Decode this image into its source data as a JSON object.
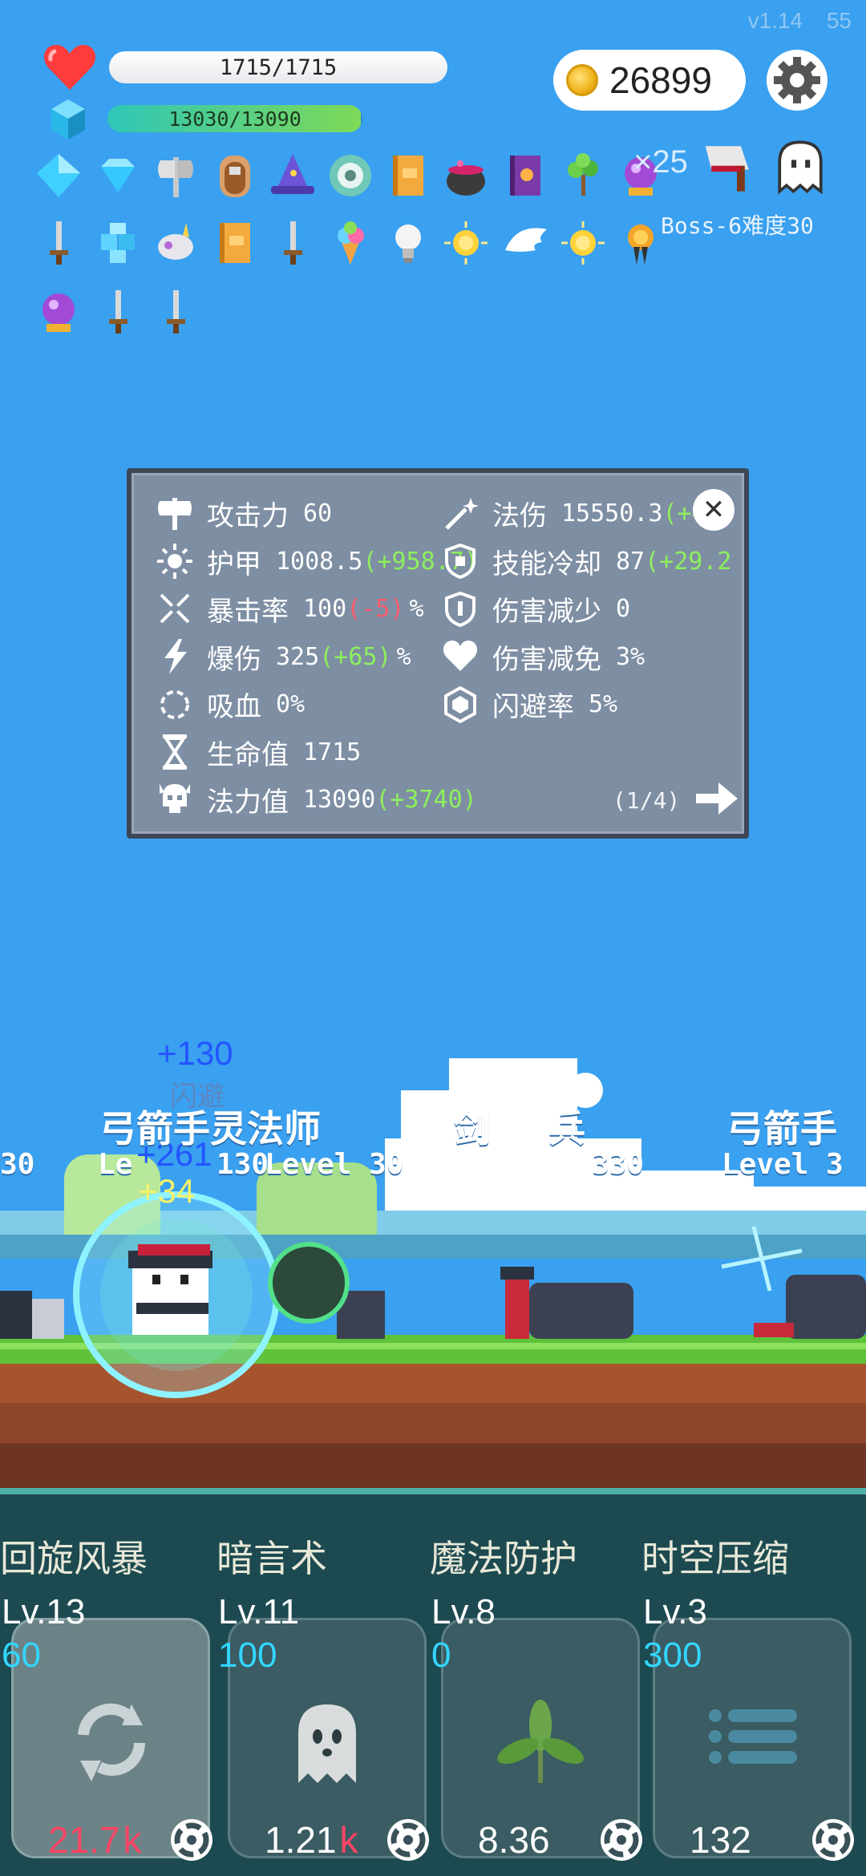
{
  "hud": {
    "version": "v1.14",
    "version_suffix": "55",
    "hp_text": "1715/1715",
    "hp_fraction": 1.0,
    "mp_text": "13030/13090",
    "mp_fraction": 0.995,
    "gold": "26899"
  },
  "inventory": {
    "stack_count": "×25",
    "boss_label": "Boss-6难度30",
    "items": [
      "diamond-icon",
      "blue-gem-icon",
      "axe-icon",
      "wooden-door-icon",
      "wizard-hat-icon",
      "round-shield-icon",
      "orange-book-icon",
      "cauldron-icon",
      "purple-book-icon",
      "sapling-icon",
      "crystal-ball-icon",
      "cleaver-icon",
      "ghost-icon",
      "sword-icon",
      "ice-blocks-icon",
      "unicorn-icon",
      "orange-book-icon",
      "sword-icon",
      "ice-cream-icon",
      "lightbulb-icon",
      "gold-star-icon",
      "wing-icon",
      "gold-star-icon",
      "medal-icon",
      "crystal-ball-icon",
      "sword-icon",
      "sword-icon"
    ]
  },
  "stats_panel": {
    "left": [
      {
        "icon": "axe-icon",
        "label": "攻击力",
        "value": "60",
        "bonus": "",
        "unit": ""
      },
      {
        "icon": "sun-icon",
        "label": "护甲",
        "value": "1008.5",
        "bonus": "(+958.7)",
        "bonus_type": "pos",
        "unit": ""
      },
      {
        "icon": "crossed-swords-icon",
        "label": "暴击率",
        "value": "100",
        "bonus": "(-5)",
        "bonus_type": "neg",
        "unit": "%"
      },
      {
        "icon": "lightning-icon",
        "label": "爆伤",
        "value": "325",
        "bonus": "(+65)",
        "bonus_type": "pos",
        "unit": "%"
      },
      {
        "icon": "ring-icon",
        "label": "吸血",
        "value": "0%",
        "bonus": "",
        "unit": ""
      },
      {
        "icon": "hourglass-icon",
        "label": "生命值",
        "value": "1715",
        "bonus": "",
        "unit": ""
      },
      {
        "icon": "skull-icon",
        "label": "法力值",
        "value": "13090",
        "bonus": "(+3740)",
        "bonus_type": "pos",
        "unit": ""
      }
    ],
    "right": [
      {
        "icon": "magic-wand-icon",
        "label": "法伤",
        "value": "15550.3",
        "bonus": "(+47",
        "bonus_type": "pos",
        "unit": ""
      },
      {
        "icon": "shield-icon",
        "label": "技能冷却",
        "value": "87",
        "bonus": "(+29.2",
        "bonus_type": "pos",
        "unit": ""
      },
      {
        "icon": "shield-check-icon",
        "label": "伤害减少",
        "value": "0",
        "bonus": "",
        "unit": ""
      },
      {
        "icon": "heart-icon",
        "label": "伤害减免",
        "value": "3%",
        "bonus": "",
        "unit": ""
      },
      {
        "icon": "hexagon-icon",
        "label": "闪避率",
        "value": "5%",
        "bonus": "",
        "unit": ""
      }
    ],
    "page": "(1/4)"
  },
  "battle": {
    "float_texts": [
      "+130",
      "闪避",
      "+261",
      "+34"
    ],
    "enemies": [
      {
        "name": "弓箭手灵法师",
        "level": "Level 30"
      },
      {
        "name": "剑",
        "suffix": "兵",
        "level": "330"
      },
      {
        "name": "弓箭手",
        "level": "Level 3"
      }
    ],
    "left_level_fragment": "30",
    "mid_level_fragment": "Le",
    "overlap_level": "130"
  },
  "skills": [
    {
      "name": "回旋风暴",
      "level": "Lv.13",
      "cost": "60",
      "price": "21.7",
      "price_unit": "k",
      "icon": "swirl-icon",
      "active": true
    },
    {
      "name": "暗言术",
      "level": "Lv.11",
      "cost": "100",
      "price": "1.21",
      "price_unit": "k",
      "icon": "ghost-icon",
      "active": false
    },
    {
      "name": "魔法防护",
      "level": "Lv.8",
      "cost": "0",
      "price": "8.36",
      "price_unit": "",
      "icon": "leaf-icon",
      "active": false
    },
    {
      "name": "时空压缩",
      "level": "Lv.3",
      "cost": "300",
      "price": "132",
      "price_unit": "",
      "icon": "list-icon",
      "active": false
    }
  ],
  "colors": {
    "sky": "#3aa0f0",
    "grass": "#5fc23b",
    "dirt": "#a7542e",
    "panel": "#7e8ea3",
    "bonus_pos": "#8df05c",
    "bonus_neg": "#ff5d6c",
    "skillbar": "#1c4a50"
  }
}
